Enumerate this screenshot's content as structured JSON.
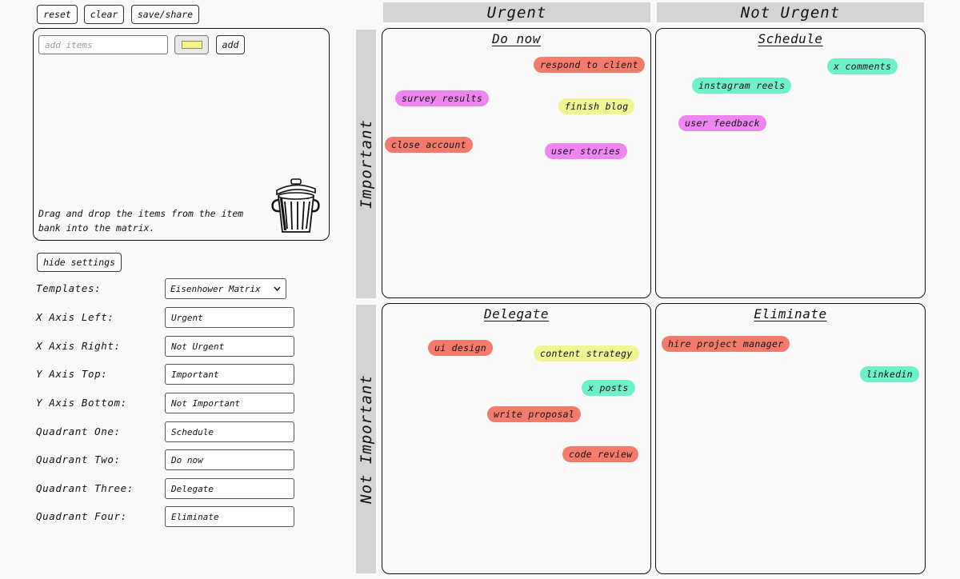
{
  "toolbar": {
    "reset": "reset",
    "clear": "clear",
    "save_share": "save/share"
  },
  "item_bank": {
    "placeholder": "add items",
    "add": "add",
    "selected_color": "#f1f58c",
    "help": "Drag and drop the items from the item bank into the matrix."
  },
  "settings": {
    "hide_button": "hide settings",
    "templates_label": "Templates:",
    "templates_value": "Eisenhower Matrix",
    "x_left_label": "X Axis Left:",
    "x_left_value": "Urgent",
    "x_right_label": "X Axis Right:",
    "x_right_value": "Not Urgent",
    "y_top_label": "Y Axis Top:",
    "y_top_value": "Important",
    "y_bottom_label": "Y Axis Bottom:",
    "y_bottom_value": "Not Important",
    "q1_label": "Quadrant One:",
    "q1_value": "Schedule",
    "q2_label": "Quadrant Two:",
    "q2_value": "Do now",
    "q3_label": "Quadrant Three:",
    "q3_value": "Delegate",
    "q4_label": "Quadrant Four:",
    "q4_value": "Eliminate"
  },
  "matrix": {
    "x_left": "Urgent",
    "x_right": "Not Urgent",
    "y_top": "Important",
    "y_bottom": "Not Important",
    "q_top_left": "Do now",
    "q_top_right": "Schedule",
    "q_bottom_left": "Delegate",
    "q_bottom_right": "Eliminate"
  },
  "colors": {
    "red": "#f47a6b",
    "pink": "#ee85f0",
    "yellow": "#eef592",
    "green": "#6ef0c8"
  },
  "items": {
    "respond_to_client": "respond to client",
    "survey_results": "survey results",
    "finish_blog": "finish blog",
    "close_account": "close account",
    "user_stories": "user stories",
    "x_comments": "x comments",
    "instagram_reels": "instagram reels",
    "user_feedback": "user feedback",
    "ui_design": "ui design",
    "content_strategy": "content strategy",
    "x_posts": "x posts",
    "write_proposal": "write proposal",
    "code_review": "code review",
    "hire_project_manager": "hire project manager",
    "linkedin": "linkedin"
  }
}
